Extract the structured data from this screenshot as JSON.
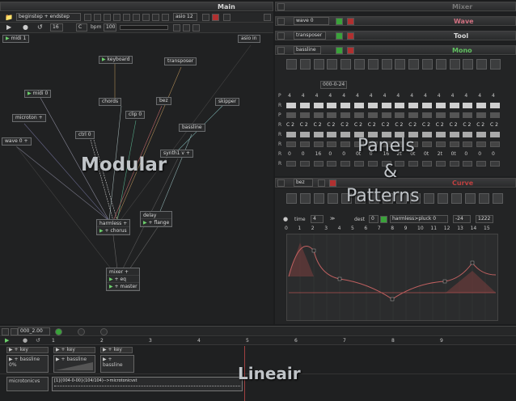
{
  "main": {
    "title": "Main",
    "file_name": "beginstep",
    "file_name2": "endstep",
    "audio_device": "asio 12",
    "bpm_label": "bpm",
    "bpm_value": "100",
    "steps": "16",
    "key": "C",
    "midi_node": "midi",
    "midi_value": "1",
    "asio_in": "asio in"
  },
  "modular": {
    "label": "Modular",
    "nodes": {
      "keyboard": "keyboard",
      "transposer": "transposer",
      "midi": "midi",
      "midi_value": "0",
      "chords": "chords",
      "bez": "bez",
      "skipper": "skipper",
      "clip": "clip",
      "clip_value": "0",
      "microton": "microton",
      "ctrl": "ctrl",
      "ctrl_value": "0",
      "bassline": "bassline",
      "wave": "wave",
      "wave_value": "0",
      "synth1": "synth1",
      "delay": "delay",
      "flange": "flange",
      "harmless": "harmless",
      "chorus": "chorus",
      "mixer": "mixer",
      "eq": "eq",
      "master": "master"
    }
  },
  "mixer": {
    "title": "Mixer"
  },
  "wave_panel": {
    "title": "Wave",
    "label": "wave",
    "value": "0"
  },
  "tool_panel": {
    "title": "Tool",
    "label": "transposer"
  },
  "mono_panel": {
    "title": "Mono",
    "label": "bassline",
    "pattern_label": "000-0-24",
    "row_numbers": [
      "4",
      "4",
      "4",
      "4",
      "4",
      "4",
      "4",
      "4",
      "4",
      "4",
      "4",
      "4",
      "4",
      "4",
      "4",
      "4"
    ],
    "notes": [
      "C 2",
      "C 2",
      "C 2",
      "C 2",
      "C 2",
      "C 2",
      "C 2",
      "C 2",
      "C 2",
      "C 2",
      "C 2",
      "C 2",
      "C 2",
      "C 2",
      "C 2",
      "C 2"
    ],
    "vals": [
      "0",
      "0",
      "16",
      "0",
      "0",
      "0t",
      "0",
      "16",
      "2t",
      "0t",
      "0t",
      "2t",
      "0t",
      "0",
      "0",
      "0"
    ]
  },
  "curve_panel": {
    "title": "Curve",
    "label": "bez",
    "time_label": "time",
    "time_value": "4",
    "dest_label": "dest",
    "dest_value": "0",
    "target": "harmless>pluck",
    "target_value": "0",
    "min_value": "-24",
    "max_value": "1222",
    "ticks": [
      "0",
      "1",
      "2",
      "3",
      "4",
      "5",
      "6",
      "7",
      "8",
      "9",
      "10",
      "11",
      "12",
      "13",
      "14",
      "15"
    ]
  },
  "overlays": {
    "panels_line1": "Panels",
    "panels_amp": "&",
    "panels_line2": "Patterns",
    "lineair": "Lineair"
  },
  "timeline": {
    "position": "000_2.00",
    "ruler": [
      "1",
      "2",
      "3",
      "4",
      "5",
      "6",
      "7",
      "8",
      "9"
    ],
    "track1_key": "key",
    "track2_key": "key",
    "track3_key": "key",
    "clip1": "bassline",
    "clip1_sub": "0%",
    "clip2": "bassline",
    "clip3": "bassline",
    "track_micro": "microtonicvs",
    "micro_clip": "[1]{004-0-00}(104/104)-->microtonicvst"
  },
  "colors": {
    "wave_accent": "#d07080",
    "mono_accent": "#60c060",
    "curve_accent": "#c04040"
  }
}
